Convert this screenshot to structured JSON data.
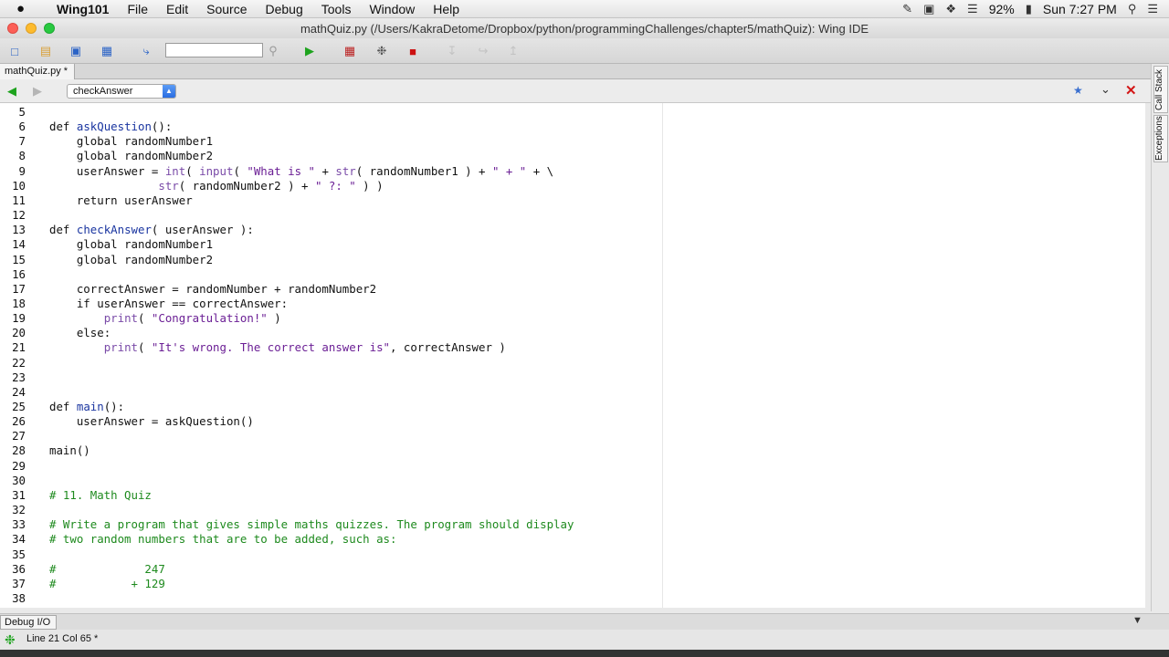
{
  "menubar": {
    "apple": "",
    "app": "Wing101",
    "items": [
      "File",
      "Edit",
      "Source",
      "Debug",
      "Tools",
      "Window",
      "Help"
    ],
    "battery": "92%",
    "clock": "Sun 7:27 PM"
  },
  "window": {
    "title": "mathQuiz.py (/Users/KakraDetome/Dropbox/python/programmingChallenges/chapter5/mathQuiz): Wing IDE"
  },
  "toolbar": {
    "search_placeholder": ""
  },
  "editor": {
    "tab_label": "mathQuiz.py *",
    "function_selector": "checkAnswer",
    "line_numbers": [
      "5",
      "6",
      "7",
      "8",
      "9",
      "10",
      "11",
      "12",
      "13",
      "14",
      "15",
      "16",
      "17",
      "18",
      "19",
      "20",
      "21",
      "22",
      "23",
      "24",
      "25",
      "26",
      "27",
      "28",
      "29",
      "30",
      "31",
      "32",
      "33",
      "34",
      "35",
      "36",
      "37",
      "38"
    ],
    "lines": [
      "",
      "def askQuestion():",
      "    global randomNumber1",
      "    global randomNumber2",
      "    userAnswer = int( input( \"What is \" + str( randomNumber1 ) + \" + \" + \\",
      "                str( randomNumber2 ) + \" ?: \" ) )",
      "    return userAnswer",
      "",
      "def checkAnswer( userAnswer ):",
      "    global randomNumber1",
      "    global randomNumber2",
      "",
      "    correctAnswer = randomNumber + randomNumber2",
      "    if userAnswer == correctAnswer:",
      "        print( \"Congratulation!\" )",
      "    else:",
      "        print( \"It's wrong. The correct answer is\", correctAnswer )",
      "",
      "",
      "",
      "def main():",
      "    userAnswer = askQuestion()",
      "",
      "main()",
      "",
      "",
      "# 11. Math Quiz",
      "",
      "# Write a program that gives simple maths quizzes. The program should display",
      "# two random numbers that are to be added, such as:",
      "",
      "#             247",
      "#           + 129",
      ""
    ]
  },
  "sidebar": {
    "tabs": [
      "Call Stack",
      "Exceptions"
    ]
  },
  "bottom": {
    "tab_label": "Debug I/O",
    "status": "Line 21 Col 65 *"
  },
  "colors": {
    "keyword": "#111111",
    "function_name": "#1a35a0",
    "string": "#6b1f95",
    "comment": "#1e8a1e",
    "builtin": "#7a4ba8",
    "run_button": "#1ea31e",
    "stop_button": "#cc1111"
  }
}
